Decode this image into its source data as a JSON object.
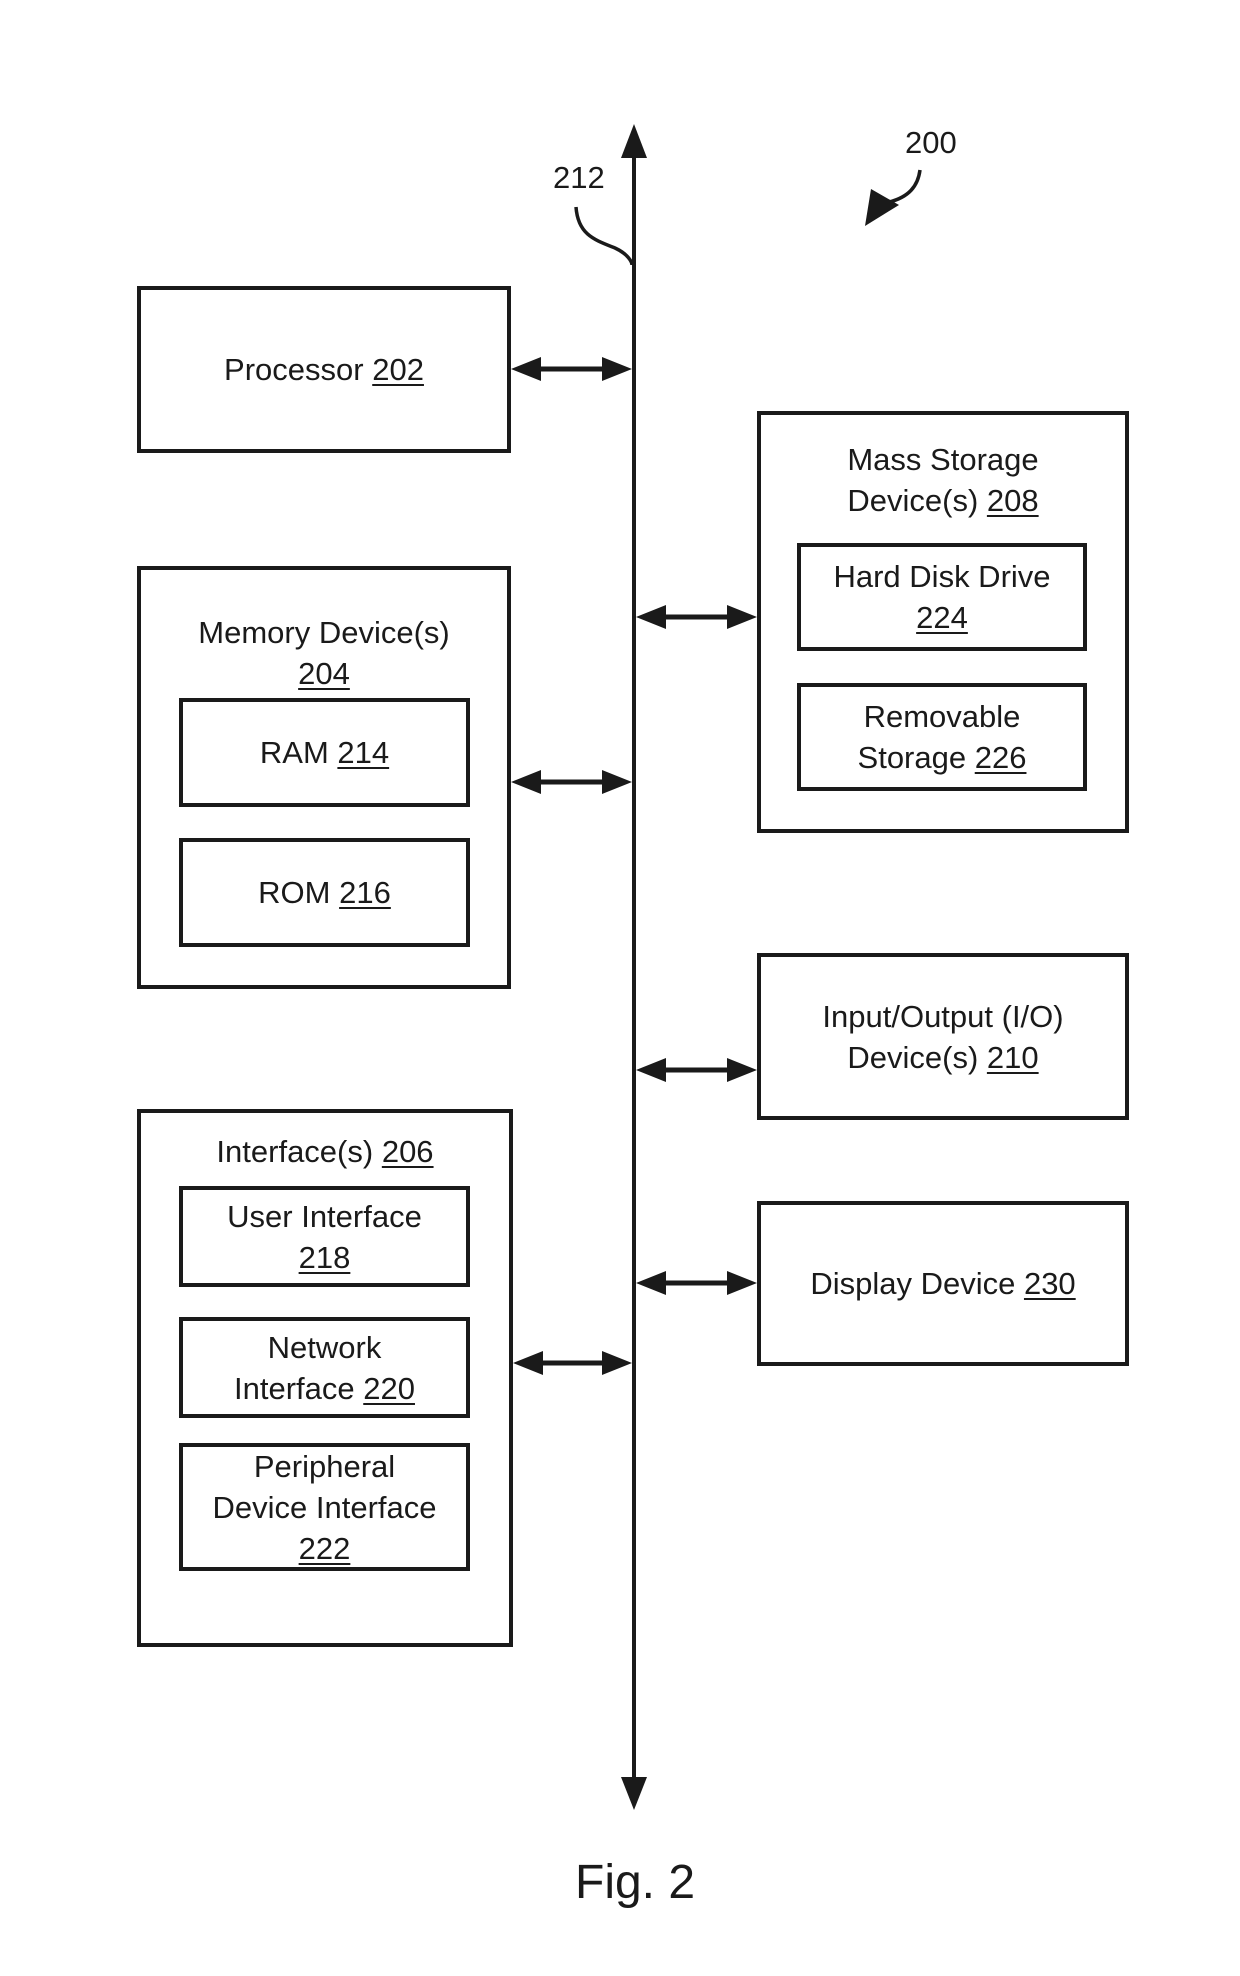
{
  "figure": {
    "caption": "Fig. 2",
    "reference": "200",
    "bus_reference": "212"
  },
  "blocks": {
    "processor": {
      "name": "Processor",
      "ref": "202"
    },
    "memory": {
      "name": "Memory Device(s)",
      "ref": "204",
      "children": [
        {
          "name": "RAM",
          "ref": "214"
        },
        {
          "name": "ROM",
          "ref": "216"
        }
      ]
    },
    "interfaces": {
      "name": "Interface(s)",
      "ref": "206",
      "children": [
        {
          "name": "User Interface",
          "ref": "218"
        },
        {
          "name_line1": "Network",
          "name_line2": "Interface",
          "ref": "220"
        },
        {
          "name_line1": "Peripheral",
          "name_line2": "Device Interface",
          "ref": "222"
        }
      ]
    },
    "mass_storage": {
      "name_line1": "Mass Storage",
      "name_line2": "Device(s)",
      "ref": "208",
      "children": [
        {
          "name": "Hard Disk Drive",
          "ref": "224"
        },
        {
          "name_line1": "Removable",
          "name_line2": "Storage",
          "ref": "226"
        }
      ]
    },
    "io": {
      "name_line1": "Input/Output (I/O)",
      "name_line2": "Device(s)",
      "ref": "210"
    },
    "display": {
      "name": "Display Device",
      "ref": "230"
    }
  },
  "connections": [
    {
      "from": "processor",
      "to": "bus",
      "type": "bidirectional"
    },
    {
      "from": "memory",
      "to": "bus",
      "type": "bidirectional"
    },
    {
      "from": "interfaces",
      "to": "bus",
      "type": "bidirectional"
    },
    {
      "from": "mass_storage",
      "to": "bus",
      "type": "bidirectional"
    },
    {
      "from": "io",
      "to": "bus",
      "type": "bidirectional"
    },
    {
      "from": "display",
      "to": "bus",
      "type": "bidirectional"
    }
  ]
}
